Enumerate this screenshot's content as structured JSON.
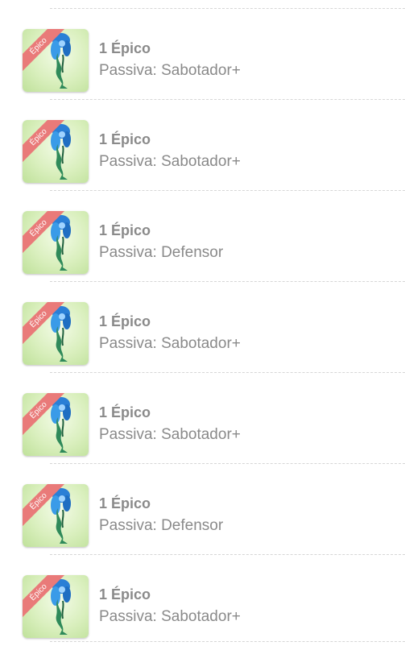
{
  "items": [
    {
      "title": "1 Épico",
      "passive": "Passiva: Sabotador+",
      "badge": "Épico",
      "icon": "mermaid-creature-icon"
    },
    {
      "title": "1 Épico",
      "passive": "Passiva: Sabotador+",
      "badge": "Épico",
      "icon": "mermaid-creature-icon"
    },
    {
      "title": "1 Épico",
      "passive": "Passiva: Defensor",
      "badge": "Épico",
      "icon": "mermaid-creature-icon"
    },
    {
      "title": "1 Épico",
      "passive": "Passiva: Sabotador+",
      "badge": "Épico",
      "icon": "mermaid-creature-icon"
    },
    {
      "title": "1 Épico",
      "passive": "Passiva: Sabotador+",
      "badge": "Épico",
      "icon": "mermaid-creature-icon"
    },
    {
      "title": "1 Épico",
      "passive": "Passiva: Defensor",
      "badge": "Épico",
      "icon": "mermaid-creature-icon"
    },
    {
      "title": "1 Épico",
      "passive": "Passiva: Sabotador+",
      "badge": "Épico",
      "icon": "mermaid-creature-icon"
    }
  ],
  "colors": {
    "badge": "#e97a79",
    "text": "#8a8a8a",
    "thumb_bg": "#d9efbd",
    "divider": "#d6d6d6"
  }
}
